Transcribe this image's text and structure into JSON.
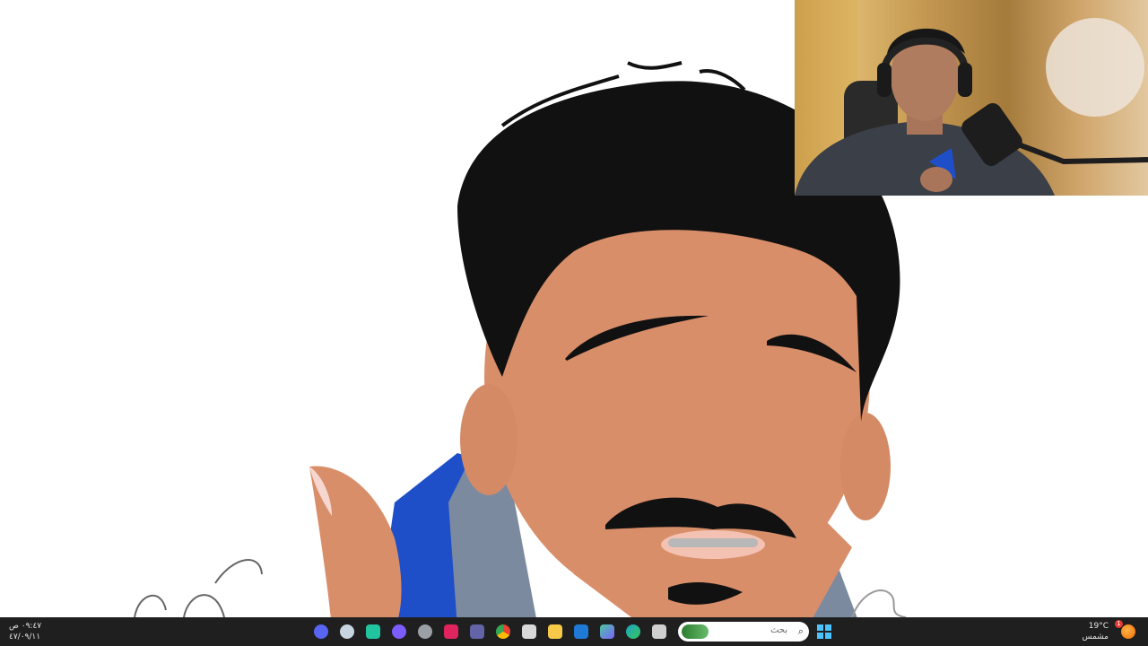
{
  "canvas": {
    "subject": "drawing-canvas",
    "skin_color": "#d98e6a",
    "hair_color": "#111111",
    "shirt_color": "#1e4fc9",
    "background_color": "#ffffff"
  },
  "webcam": {
    "name": "webcam-overlay"
  },
  "taskbar": {
    "time": "٠٩:٤٧ ص",
    "date": "٤٧/٠٩/١١",
    "weather_temp": "19°C",
    "weather_label": "مشمس",
    "notification_count": "1",
    "search_placeholder": "بحث",
    "apps": [
      {
        "name": "discord",
        "icon": "discord-icon",
        "color": "#5865f2"
      },
      {
        "name": "steam",
        "icon": "steam-icon",
        "color": "#c7d5e0"
      },
      {
        "name": "app-green",
        "icon": "app-icon",
        "color": "#22c4a0"
      },
      {
        "name": "app-purple",
        "icon": "app-icon",
        "color": "#7a5cff"
      },
      {
        "name": "settings",
        "icon": "gear-icon",
        "color": "#9aa0a6"
      },
      {
        "name": "adobe",
        "icon": "adobe-icon",
        "color": "#e0245e"
      },
      {
        "name": "teams",
        "icon": "teams-icon",
        "color": "#6264a7"
      },
      {
        "name": "chrome",
        "icon": "chrome-icon",
        "color": "#f2b81a"
      },
      {
        "name": "store",
        "icon": "store-icon",
        "color": "#d9d9d9"
      },
      {
        "name": "explorer",
        "icon": "folder-icon",
        "color": "#f7c948"
      },
      {
        "name": "outlook",
        "icon": "mail-icon",
        "color": "#1f7ad6"
      },
      {
        "name": "copilot",
        "icon": "copilot-icon",
        "color": "#4bc7a0"
      },
      {
        "name": "edge",
        "icon": "edge-icon",
        "color": "#1ea3c6"
      },
      {
        "name": "notepad",
        "icon": "notepad-icon",
        "color": "#cfcfcf"
      }
    ]
  }
}
